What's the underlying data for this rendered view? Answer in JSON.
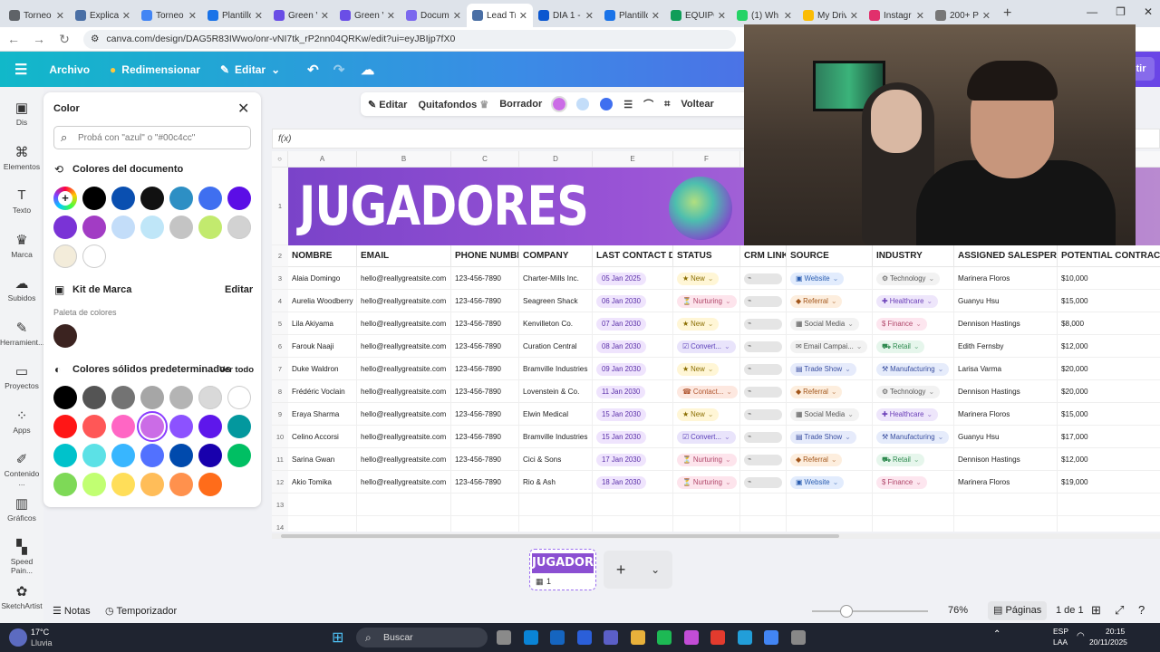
{
  "browser": {
    "tabs": [
      {
        "label": "Torneo",
        "color": "#5f6368"
      },
      {
        "label": "Explicac",
        "color": "#4a6fa5"
      },
      {
        "label": "Torneo",
        "color": "#4285f4"
      },
      {
        "label": "Plantillo",
        "color": "#1a73e8"
      },
      {
        "label": "Green V",
        "color": "#6a4ee6"
      },
      {
        "label": "Green V",
        "color": "#6a4ee6"
      },
      {
        "label": "Docum",
        "color": "#7b68ee"
      },
      {
        "label": "Lead Tr",
        "color": "#4a6fa5",
        "active": true
      },
      {
        "label": "DIA 1 -",
        "color": "#0b57d0"
      },
      {
        "label": "Plantillo",
        "color": "#1a73e8"
      },
      {
        "label": "EQUIPO",
        "color": "#0f9d58"
      },
      {
        "label": "(1) Wh",
        "color": "#25d366"
      },
      {
        "label": "My Driv",
        "color": "#fbbc04"
      },
      {
        "label": "Instagr",
        "color": "#e1306c"
      },
      {
        "label": "200+ P",
        "color": "#777777"
      }
    ],
    "new_tab": "+",
    "url": "canva.com/design/DAG5R83IWwo/onr-vNI7tk_rP2nn04QRKw/edit?ui=eyJBIjp7fX0"
  },
  "canva": {
    "archivo": "Archivo",
    "redimensionar": "Redimensionar",
    "editar": "Editar",
    "compartir_tail": "tir"
  },
  "rail": [
    {
      "label": "Dis",
      "icon": "layout-icon",
      "glyph": "▣"
    },
    {
      "label": "Elementos",
      "icon": "elements-icon",
      "glyph": "⌘"
    },
    {
      "label": "Texto",
      "icon": "text-icon",
      "glyph": "T"
    },
    {
      "label": "Marca",
      "icon": "brand-icon",
      "glyph": "♛"
    },
    {
      "label": "Subidos",
      "icon": "upload-icon",
      "glyph": "☁"
    },
    {
      "label": "Herramient...",
      "icon": "tools-icon",
      "glyph": "✎"
    },
    {
      "label": "Proyectos",
      "icon": "folder-icon",
      "glyph": "▭"
    },
    {
      "label": "Apps",
      "icon": "apps-icon",
      "glyph": "⁘"
    },
    {
      "label": "Contenido ...",
      "icon": "content-icon",
      "glyph": "✐"
    },
    {
      "label": "Gráficos",
      "icon": "chart-icon",
      "glyph": "▥"
    },
    {
      "label": "Speed Pain...",
      "icon": "paint-icon",
      "glyph": "▚"
    },
    {
      "label": "SketchArtist",
      "icon": "sketch-icon",
      "glyph": "✿"
    }
  ],
  "color_panel": {
    "title": "Color",
    "search_placeholder": "Probá con \"azul\" o \"#00c4cc\"",
    "doc_colors_title": "Colores del documento",
    "doc_colors": [
      "#000000",
      "#0a4fb0",
      "#111111",
      "#2d8fc4",
      "#3f6ff0",
      "#5b0ee6",
      "#7a33d6",
      "#a23cc4",
      "#c3ddf9",
      "#bfe6f8",
      "#c4c4c4",
      "#c2ea6e",
      "#d2d2d2",
      "#f3ecda",
      "#ffffff"
    ],
    "brand_kit_title": "Kit de Marca",
    "brand_edit": "Editar",
    "palette_label": "Paleta de colores",
    "brand_colors": [
      "#3b2320"
    ],
    "solid_title": "Colores sólidos predeterminados",
    "see_all": "Ver todo",
    "solid_colors": [
      "#000000",
      "#545454",
      "#737373",
      "#a6a6a6",
      "#b4b4b4",
      "#d9d9d9",
      "#ffffff",
      "#ff1616",
      "#ff5757",
      "#ff66c4",
      "#cb6ce6",
      "#8c52ff",
      "#5e17eb",
      "#03989e",
      "#00c2cb",
      "#5ce1e6",
      "#38b6ff",
      "#5271ff",
      "#004aad",
      "#1800ad",
      "#00bf63",
      "#7ed957",
      "#c1ff72",
      "#ffde59",
      "#ffbd59",
      "#ff914d",
      "#ff6c1a"
    ],
    "selected_color": "#cb6ce6"
  },
  "canvas_toolbar": {
    "editar": "Editar",
    "quitafondos": "Quitafondos",
    "borrador": "Borrador",
    "voltear": "Voltear"
  },
  "sheet": {
    "fx": "f(x)",
    "columns": [
      "A",
      "B",
      "C",
      "D",
      "E",
      "F",
      "G",
      "H",
      "I",
      "J",
      "K"
    ],
    "banner_title": "JUGADORES",
    "headers": [
      "NOMBRE",
      "EMAIL",
      "PHONE NUMBER",
      "COMPANY",
      "LAST CONTACT DATE",
      "STATUS",
      "CRM LINK",
      "SOURCE",
      "INDUSTRY",
      "ASSIGNED SALESPERSON",
      "POTENTIAL CONTRACT VAL"
    ],
    "rows": [
      {
        "n": "3",
        "name": "Alaia Domingo",
        "email": "hello@reallygreatsite.com",
        "phone": "123-456-7890",
        "company": "Charter-Mills Inc.",
        "date": "05 Jan 2025",
        "status": "New",
        "source": "Website",
        "industry": "Technology",
        "sales": "Marinera Floros",
        "value": "$10,000"
      },
      {
        "n": "4",
        "name": "Aurelia Woodberry",
        "email": "hello@reallygreatsite.com",
        "phone": "123-456-7890",
        "company": "Seagreen Shack",
        "date": "06 Jan 2030",
        "status": "Nurturing",
        "source": "Referral",
        "industry": "Healthcare",
        "sales": "Guanyu Hsu",
        "value": "$15,000"
      },
      {
        "n": "5",
        "name": "Lila Akiyama",
        "email": "hello@reallygreatsite.com",
        "phone": "123-456-7890",
        "company": "Kenvilleton Co.",
        "date": "07 Jan 2030",
        "status": "New",
        "source": "Social Media",
        "industry": "Finance",
        "sales": "Dennison Hastings",
        "value": "$8,000"
      },
      {
        "n": "6",
        "name": "Farouk Naaji",
        "email": "hello@reallygreatsite.com",
        "phone": "123-456-7890",
        "company": "Curation Central",
        "date": "08 Jan 2030",
        "status": "Convert...",
        "source": "Email Campai...",
        "industry": "Retail",
        "sales": "Edith Fernsby",
        "value": "$12,000"
      },
      {
        "n": "7",
        "name": "Duke Waldron",
        "email": "hello@reallygreatsite.com",
        "phone": "123-456-7890",
        "company": "Bramville Industries",
        "date": "09 Jan 2030",
        "status": "New",
        "source": "Trade Show",
        "industry": "Manufacturing",
        "sales": "Larisa Varma",
        "value": "$20,000"
      },
      {
        "n": "8",
        "name": "Frédéric Voclain",
        "email": "hello@reallygreatsite.com",
        "phone": "123-456-7890",
        "company": "Lovenstein & Co.",
        "date": "11 Jan 2030",
        "status": "Contact...",
        "source": "Referral",
        "industry": "Technology",
        "sales": "Dennison Hastings",
        "value": "$20,000"
      },
      {
        "n": "9",
        "name": "Eraya Sharma",
        "email": "hello@reallygreatsite.com",
        "phone": "123-456-7890",
        "company": "Elwin Medical",
        "date": "15 Jan 2030",
        "status": "New",
        "source": "Social Media",
        "industry": "Healthcare",
        "sales": "Marinera Floros",
        "value": "$15,000"
      },
      {
        "n": "10",
        "name": "Celino Accorsi",
        "email": "hello@reallygreatsite.com",
        "phone": "123-456-7890",
        "company": "Bramville Industries",
        "date": "15 Jan 2030",
        "status": "Convert...",
        "source": "Trade Show",
        "industry": "Manufacturing",
        "sales": "Guanyu Hsu",
        "value": "$17,000"
      },
      {
        "n": "11",
        "name": "Sarina Gwan",
        "email": "hello@reallygreatsite.com",
        "phone": "123-456-7890",
        "company": "Cici & Sons",
        "date": "17 Jan 2030",
        "status": "Nurturing",
        "source": "Referral",
        "industry": "Retail",
        "sales": "Dennison Hastings",
        "value": "$12,000"
      },
      {
        "n": "12",
        "name": "Akio Tomika",
        "email": "hello@reallygreatsite.com",
        "phone": "123-456-7890",
        "company": "Rio & Ash",
        "date": "18 Jan 2030",
        "status": "Nurturing",
        "source": "Website",
        "industry": "Finance",
        "sales": "Marinera Floros",
        "value": "$19,000"
      }
    ],
    "extra_rows": [
      "13",
      "14"
    ]
  },
  "pages": {
    "thumb_title": "JUGADORES",
    "thumb_count": "1",
    "add": "+"
  },
  "status": {
    "notas": "Notas",
    "temporizador": "Temporizador",
    "zoom": "76%",
    "zoom_level": 0.3,
    "paginas": "Páginas",
    "page_of": "1 de 1"
  },
  "taskbar": {
    "weather_temp": "17°C",
    "weather_desc": "Lluvia",
    "search": "Buscar",
    "lang1": "ESP",
    "lang2": "LAA",
    "time": "20:15",
    "date": "20/11/2025"
  }
}
